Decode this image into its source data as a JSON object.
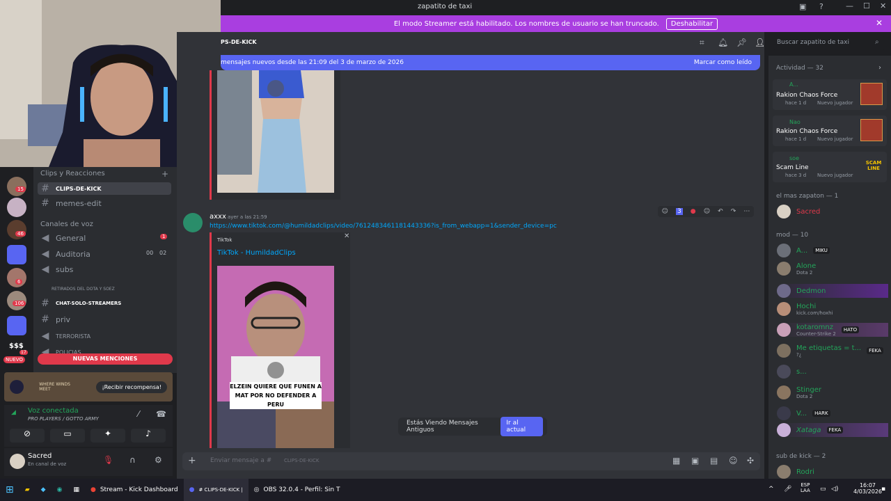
{
  "window": {
    "title": "zapatito de taxi"
  },
  "banner": {
    "text": "El modo Streamer está habilitado. Los nombres de usuario se han truncado.",
    "button": "Deshabilitar"
  },
  "channel_header": {
    "name": "PS-DE-KICK"
  },
  "search": {
    "placeholder": "Buscar zapatito de taxi"
  },
  "newmsg": {
    "text": "mensajes nuevos desde las 21:09 del 3 de marzo de 2026",
    "action": "Marcar como leído"
  },
  "guild_badges": [
    "15",
    "46",
    "6",
    "106",
    "17"
  ],
  "guild_nuevo": "NUEVO",
  "guild_money": "$$$",
  "channels": {
    "cat1": "Clips y Reacciones",
    "c1": "CLIPS-DE-KICK",
    "c2": "memes-edit",
    "cat2": "Canales de voz",
    "v1": "General",
    "v1badge": "1",
    "v2": "Auditoria",
    "v2a": "00",
    "v2b": "02",
    "v3": "subs",
    "cat3": "RETIRADOS DEL DOTA Y SOEZ",
    "c3": "CHAT-SOLO-STREAMERS",
    "c4": "priv",
    "c5": "TERRORISTA",
    "c6": "POLICIAS"
  },
  "new_mentions": "NUEVAS MENCIONES",
  "promo": {
    "logo": "WHERE WINDS MEET",
    "button": "¡Recibir recompensa!"
  },
  "voice": {
    "status": "Voz conectada",
    "detail": "PRO PLAYERS / GOTTO ARMY"
  },
  "user": {
    "name": "Sacred",
    "status": "En canal de voz"
  },
  "message": {
    "author": "axxx",
    "time": "ayer a las 21:59",
    "link": "https://www.tiktok.com/@humildadclips/video/7612483461181443336?is_from_webapp=1&sender_device=pc",
    "embed_provider": "TikTok",
    "embed_title": "TikTok - HumildadClips",
    "caption": "ELZEIN QUIERE QUE FUNEN A MAT POR NO DEFENDER A PERU",
    "reaction_count": "3"
  },
  "toast": {
    "text": "Estás Viendo Mensajes Antiguos",
    "button": "Ir al actual"
  },
  "composer": {
    "placeholder": "Enviar mensaje a #",
    "channel": "CLIPS-DE-KICK"
  },
  "members": {
    "activity": "Actividad — 32",
    "a1": {
      "name": "A...",
      "game": "Rakion Chaos Force",
      "time": "hace 1 d",
      "tag": "Nuevo jugador"
    },
    "a2": {
      "name": "Nao",
      "game": "Rakion Chaos Force",
      "time": "hace 1 d",
      "tag": "Nuevo jugador"
    },
    "a3": {
      "name": "soe",
      "game": "Scam Line",
      "time": "hace 3 d",
      "tag": "Nuevo jugador"
    },
    "a3_logo": "SCAM LINE",
    "sec1": "el mas zapaton — 1",
    "m1": "Sacred",
    "sec2": "mod — 10",
    "mod": [
      {
        "name": "A...",
        "tag": "MIKU",
        "sub": ""
      },
      {
        "name": "Alone",
        "tag": "",
        "sub": "Dota 2"
      },
      {
        "name": "Dedmon",
        "tag": "",
        "sub": ""
      },
      {
        "name": "Hochi",
        "tag": "",
        "sub": "kick.com/hoxhi"
      },
      {
        "name": "kotaromnz",
        "tag": "HATO",
        "sub": "Counter-Strike 2"
      },
      {
        "name": "Me etiquetas = t...",
        "tag": "FEKA",
        "sub": "?¿"
      },
      {
        "name": "s...",
        "tag": "",
        "sub": ""
      },
      {
        "name": "Stinger",
        "tag": "",
        "sub": "Dota 2"
      },
      {
        "name": "V...",
        "tag": "HARK",
        "sub": ""
      },
      {
        "name": "Xataga",
        "tag": "FEKA",
        "sub": ""
      }
    ],
    "sec3": "sub de kick — 2",
    "s1": "Rodri"
  },
  "taskbar": {
    "chrome": "Stream - Kick Dashboard",
    "discord": "# CLIPS-DE-KICK |",
    "obs": "OBS 32.0.4 - Perfil: Sin T",
    "lang": "ESP",
    "lang2": "LAA",
    "time": "16:07",
    "date": "4/03/2026"
  }
}
